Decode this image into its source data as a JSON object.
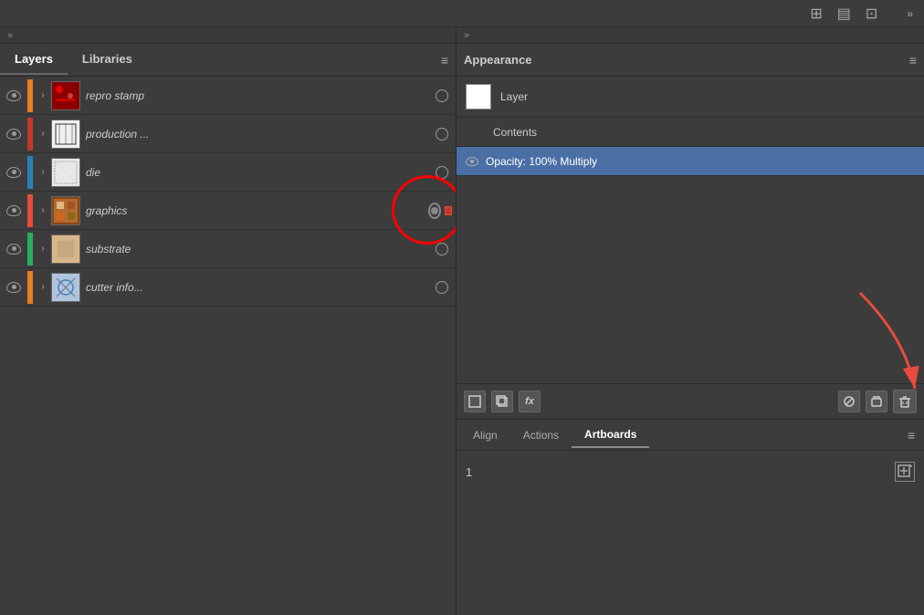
{
  "topBar": {
    "icons": [
      "grid-icon",
      "panel-icon",
      "expand-icon"
    ]
  },
  "leftPanel": {
    "tabs": [
      {
        "id": "layers",
        "label": "Layers",
        "active": true
      },
      {
        "id": "libraries",
        "label": "Libraries",
        "active": false
      }
    ],
    "collapseLabel": "»",
    "layers": [
      {
        "id": "repro-stamp",
        "name": "repro stamp",
        "color": "#e67e22",
        "visible": true,
        "hasTarget": true,
        "targetFilled": false,
        "thumbType": "repro"
      },
      {
        "id": "production",
        "name": "production ...",
        "color": "#c0392b",
        "visible": true,
        "hasTarget": true,
        "targetFilled": false,
        "thumbType": "production"
      },
      {
        "id": "die",
        "name": "die",
        "color": "#2980b9",
        "visible": true,
        "hasTarget": true,
        "targetFilled": false,
        "thumbType": "die"
      },
      {
        "id": "graphics",
        "name": "graphics",
        "color": "#e74c3c",
        "visible": true,
        "hasTarget": true,
        "targetFilled": true,
        "thumbType": "graphics",
        "annotated": true
      },
      {
        "id": "substrate",
        "name": "substrate",
        "color": "#27ae60",
        "visible": true,
        "hasTarget": true,
        "targetFilled": false,
        "thumbType": "substrate"
      },
      {
        "id": "cutter-info",
        "name": "cutter info...",
        "color": "#e67e22",
        "visible": true,
        "hasTarget": true,
        "targetFilled": false,
        "thumbType": "cutter"
      }
    ]
  },
  "rightPanel": {
    "title": "Appearance",
    "menuIcon": "≡",
    "rows": [
      {
        "id": "layer-row",
        "type": "layer",
        "label": "Layer",
        "hasPreview": true
      },
      {
        "id": "contents-row",
        "type": "contents",
        "label": "Contents",
        "hasPreview": false
      },
      {
        "id": "opacity-row",
        "type": "opacity",
        "label": "Opacity: 100% Multiply",
        "selected": true,
        "hasEye": true
      }
    ],
    "toolbar": {
      "buttons": [
        {
          "id": "square-btn",
          "icon": "□",
          "label": "new-item-button"
        },
        {
          "id": "dup-btn",
          "icon": "▣",
          "label": "duplicate-button"
        },
        {
          "id": "fx-btn",
          "icon": "fx",
          "label": "fx-button"
        },
        {
          "id": "no-btn",
          "icon": "⊘",
          "label": "no-button"
        },
        {
          "id": "mask-btn",
          "icon": "⬡",
          "label": "mask-button"
        },
        {
          "id": "delete-btn",
          "icon": "🗑",
          "label": "delete-button"
        }
      ]
    }
  },
  "bottomPanel": {
    "tabs": [
      {
        "id": "align",
        "label": "Align",
        "active": false
      },
      {
        "id": "actions",
        "label": "Actions",
        "active": false
      },
      {
        "id": "artboards",
        "label": "Artboards",
        "active": true
      }
    ],
    "artboards": [
      {
        "id": 1,
        "number": "1"
      }
    ],
    "newArtboardIcon": "⊞"
  }
}
